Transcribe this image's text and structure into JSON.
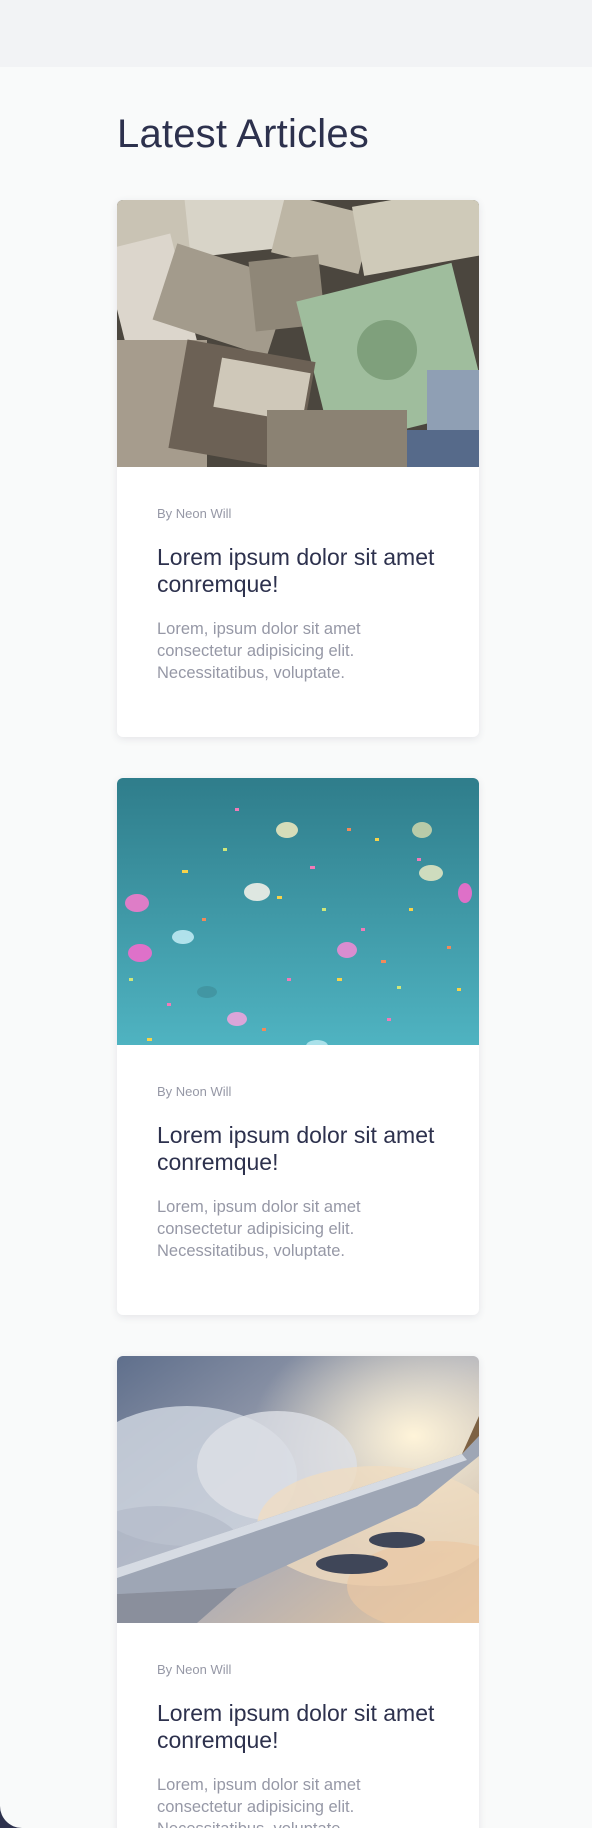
{
  "section_title": "Latest Articles",
  "articles": [
    {
      "image_subject": "currency banknotes",
      "author": "By Neon Will",
      "title": "Lorem ipsum dolor sit amet conremque!",
      "excerpt": "Lorem, ipsum dolor sit amet consectetur adipisicing elit. Necessitatibus, voluptate."
    },
    {
      "image_subject": "confetti",
      "author": "By Neon Will",
      "title": "Lorem ipsum dolor sit amet conremque!",
      "excerpt": "Lorem, ipsum dolor sit amet consectetur adipisicing elit. Necessitatibus, voluptate."
    },
    {
      "image_subject": "airplane wing above clouds",
      "author": "By Neon Will",
      "title": "Lorem ipsum dolor sit amet conremque!",
      "excerpt": "Lorem, ipsum dolor sit amet consectetur adipisicing elit. Necessitatibus, voluptate."
    }
  ],
  "colors": {
    "heading": "#2d314d",
    "muted": "#9698a6",
    "background": "#f9fafa",
    "card": "#ffffff"
  }
}
